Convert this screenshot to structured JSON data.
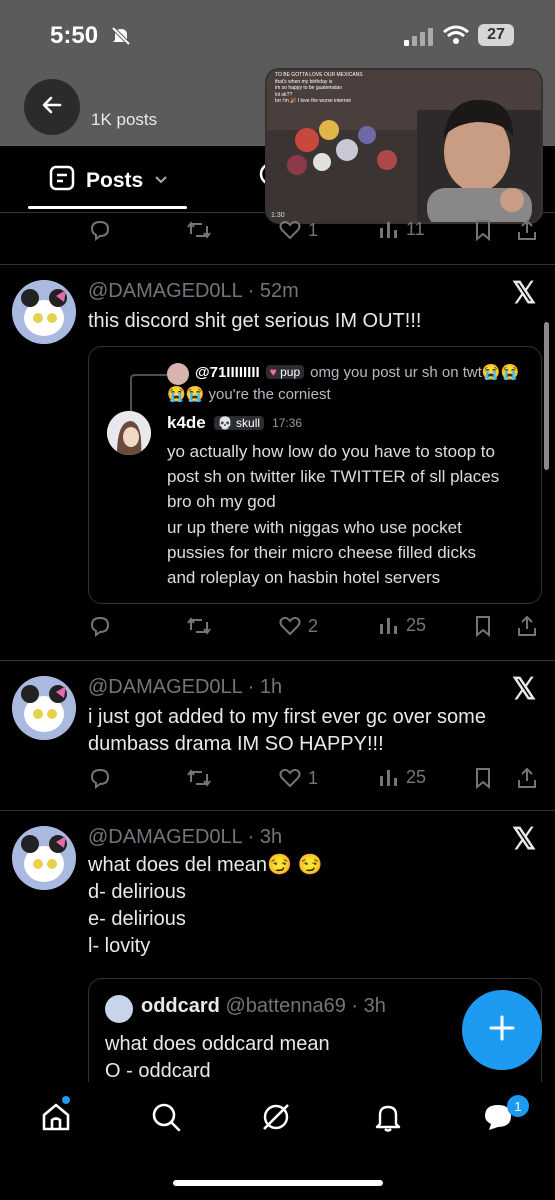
{
  "status_bar": {
    "time": "5:50",
    "battery": "27"
  },
  "header": {
    "posts_count": "1K posts"
  },
  "tabs": {
    "posts_label": "Posts"
  },
  "pip": {
    "overlay_lines": [
      "TO BE GOTTA LOVE OUR MEXICANS",
      "that's when my birthday is",
      "im so happy to be guatemalan",
      "lol ok??",
      "brr i'm 🎉 I love the worse internet"
    ],
    "corner": "1:30"
  },
  "top_actions": {
    "likes": "1",
    "views": "11"
  },
  "tweets": [
    {
      "handle": "@DAMAGED0LL",
      "time": "52m",
      "text": "this discord shit get serious IM OUT!!!",
      "actions": {
        "likes": "2",
        "views": "25"
      }
    },
    {
      "handle": "@DAMAGED0LL",
      "time": "1h",
      "text_lines": [
        "i just got added to my first ever gc over some",
        "dumbass drama IM SO HAPPY!!!"
      ],
      "actions": {
        "likes": "1",
        "views": "25"
      }
    },
    {
      "handle": "@DAMAGED0LL",
      "time": "3h",
      "text_lines": [
        "what does del mean😏 😏",
        "d- delirious",
        "e- delirious",
        "l- lovity"
      ]
    }
  ],
  "discord_embed": {
    "reply_user": "@71IIIIIIII",
    "reply_tag": "pup",
    "reply_text_1": "omg you post ur sh on twt😭😭",
    "reply_text_2": "😭😭 you're the corniest",
    "author": "k4de",
    "author_tag": "skull",
    "time": "17:36",
    "msg1_lines": [
      "yo actually how low do you have to stoop to",
      "post sh on twitter like TWITTER of sll places",
      "bro oh my god"
    ],
    "msg2_lines": [
      "ur up there with niggas who use pocket",
      "pussies for their micro cheese filled dicks",
      "and roleplay on hasbin hotel servers"
    ]
  },
  "quote": {
    "name": "oddcard",
    "handle": "@battenna69",
    "time": "3h",
    "text_lines": [
      "what does oddcard mean",
      "O - oddcard"
    ]
  },
  "nav": {
    "messages_badge": "1"
  },
  "colors": {
    "accent": "#1d9bf0",
    "muted": "#71767b",
    "text": "#e7e9ea",
    "divider": "#2f3336"
  }
}
